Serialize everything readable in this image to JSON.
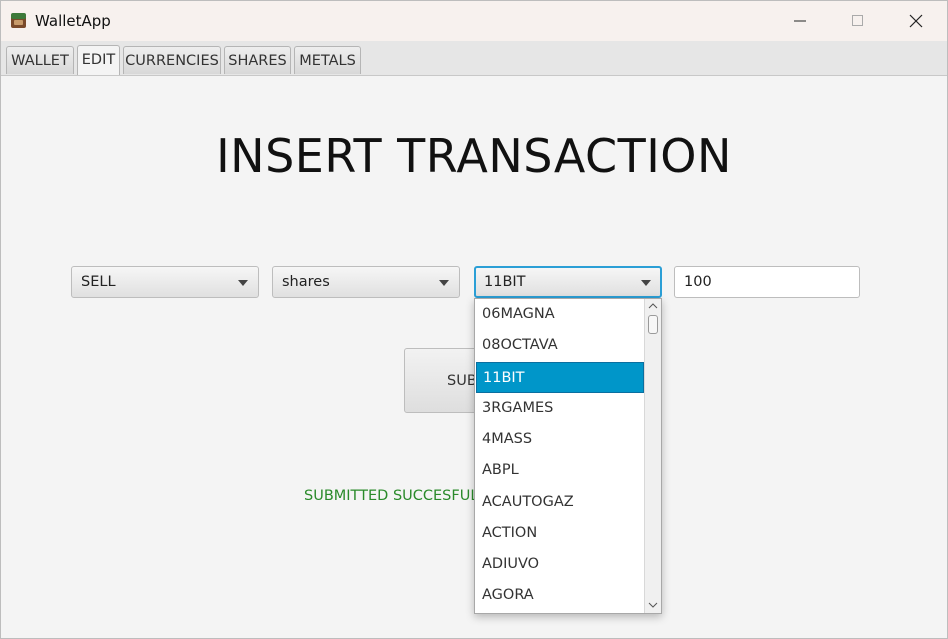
{
  "window": {
    "title": "WalletApp"
  },
  "tabs": [
    "WALLET",
    "EDIT",
    "CURRENCIES",
    "SHARES",
    "METALS"
  ],
  "active_tab": "EDIT",
  "page": {
    "heading": "INSERT TRANSACTION"
  },
  "form": {
    "action": "SELL",
    "asset_type": "shares",
    "asset": "11BIT",
    "amount": "100",
    "submit_label": "SUB",
    "status": "SUBMITTED SUCCESFULLY"
  },
  "dropdown": {
    "options": [
      "06MAGNA",
      "08OCTAVA",
      "11BIT",
      "3RGAMES",
      "4MASS",
      "ABPL",
      "ACAUTOGAZ",
      "ACTION",
      "ADIUVO",
      "AGORA"
    ],
    "selected_index": 2
  },
  "colors": {
    "accent": "#0096c9",
    "focus": "#2b9fd6",
    "status": "#2a8a2a"
  }
}
